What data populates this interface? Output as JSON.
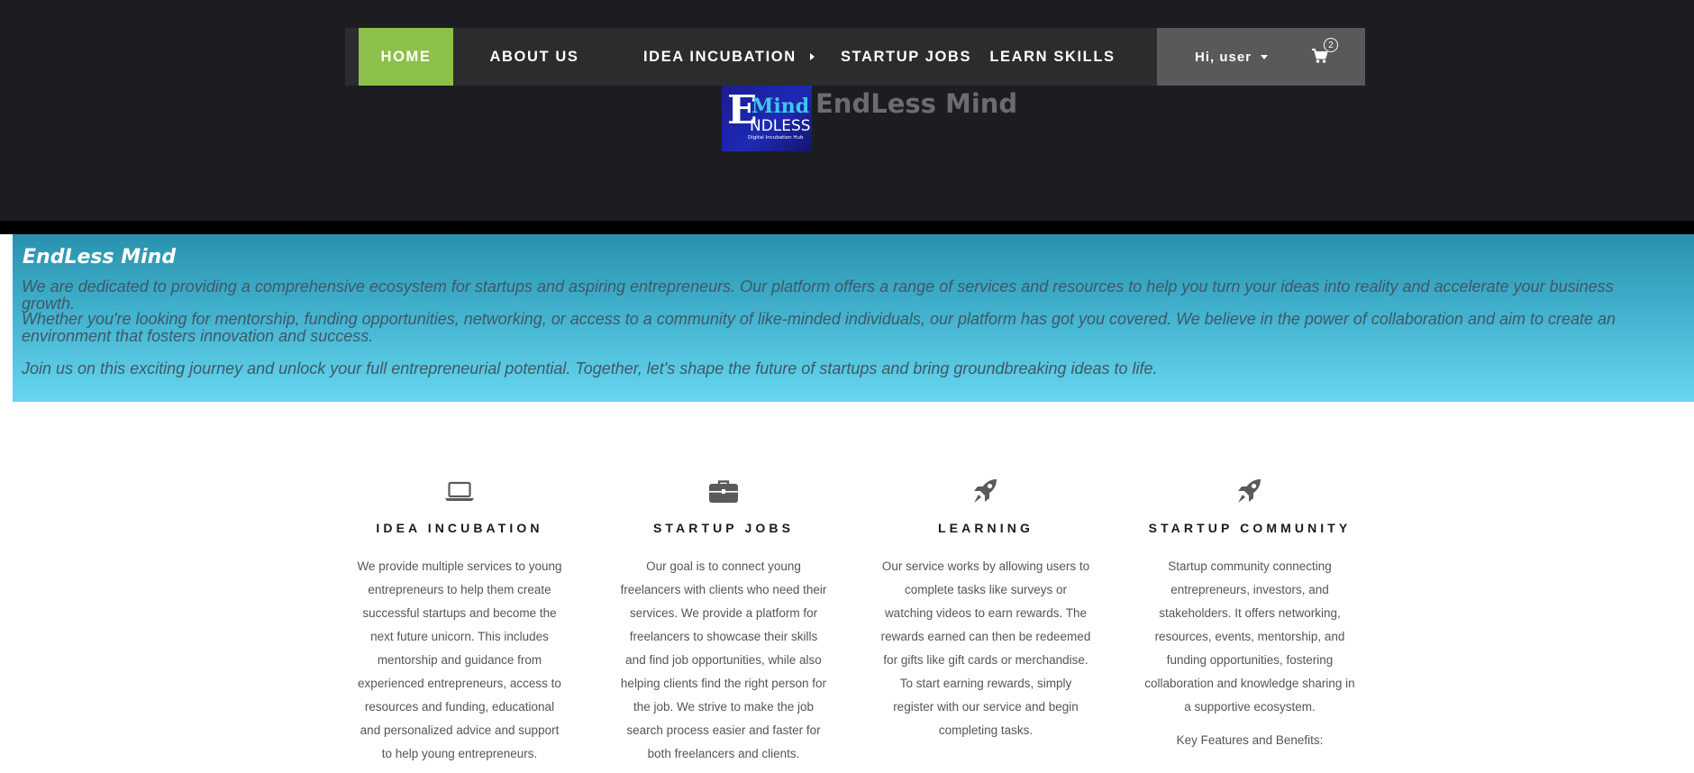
{
  "nav": {
    "items": [
      {
        "label": "HOME",
        "active": true
      },
      {
        "label": "ABOUT US"
      },
      {
        "label": "IDEA INCUBATION",
        "has_submenu": true
      },
      {
        "label": "STARTUP JOBS"
      },
      {
        "label": "LEARN SKILLS"
      }
    ],
    "user_greeting": "Hi, user",
    "cart_count": "2",
    "cart_icon": "shopping-cart-icon"
  },
  "brand": {
    "name": "EndLess Mind",
    "logo_text": {
      "big_e": "E",
      "mind": "Mind",
      "ndless": "NDLESS",
      "tagline": "Digital Incubation Hub"
    }
  },
  "about": {
    "title": "EndLess Mind",
    "paragraphs": [
      "We are dedicated to providing a comprehensive ecosystem for startups and aspiring entrepreneurs. Our platform offers a range of services and resources to help you turn your ideas into reality and accelerate your business growth.",
      "Whether you're looking for mentorship, funding opportunities, networking, or access to a community of like-minded individuals, our platform has got you covered. We believe in the power of collaboration and aim to create an environment that fosters innovation and success.",
      "Join us on this exciting journey and unlock your full entrepreneurial potential. Together, let's shape the future of startups and bring groundbreaking ideas to life."
    ]
  },
  "features": [
    {
      "icon": "laptop-icon",
      "title": "IDEA INCUBATION",
      "text": "We provide multiple services to young entrepreneurs to help them create successful startups and become the next future unicorn. This includes mentorship and guidance from experienced entrepreneurs, access to resources and funding, educational and personalized advice and support to help young entrepreneurs."
    },
    {
      "icon": "briefcase-icon",
      "title": "STARTUP JOBS",
      "text": "Our goal is to connect young freelancers with clients who need their services. We provide a platform for freelancers to showcase their skills and find job opportunities, while also helping clients find the right person for the job. We strive to make the job search process easier and faster for both freelancers and clients."
    },
    {
      "icon": "rocket-icon",
      "title": "LEARNING",
      "text": "Our service works by allowing users to complete tasks like surveys or watching videos to earn rewards. The rewards earned can then be redeemed for gifts like gift cards or merchandise. To start earning rewards, simply register with our service and begin completing tasks."
    },
    {
      "icon": "rocket-icon",
      "title": "STARTUP COMMUNITY",
      "text": "Startup community connecting entrepreneurs, investors, and stakeholders. It offers networking, resources, events, mentorship, and funding opportunities, fostering collaboration and knowledge sharing in a supportive ecosystem.",
      "extra": "Key Features and Benefits:"
    }
  ],
  "colors": {
    "header_bg": "#1c1d21",
    "nav_bg": "#2b2c2e",
    "home_active": "#8dc04a",
    "user_area_bg": "#58595b",
    "about_gradient_top": "#2892ae",
    "about_gradient_bottom": "#68d6ef",
    "icon": "#5a5a5a"
  }
}
